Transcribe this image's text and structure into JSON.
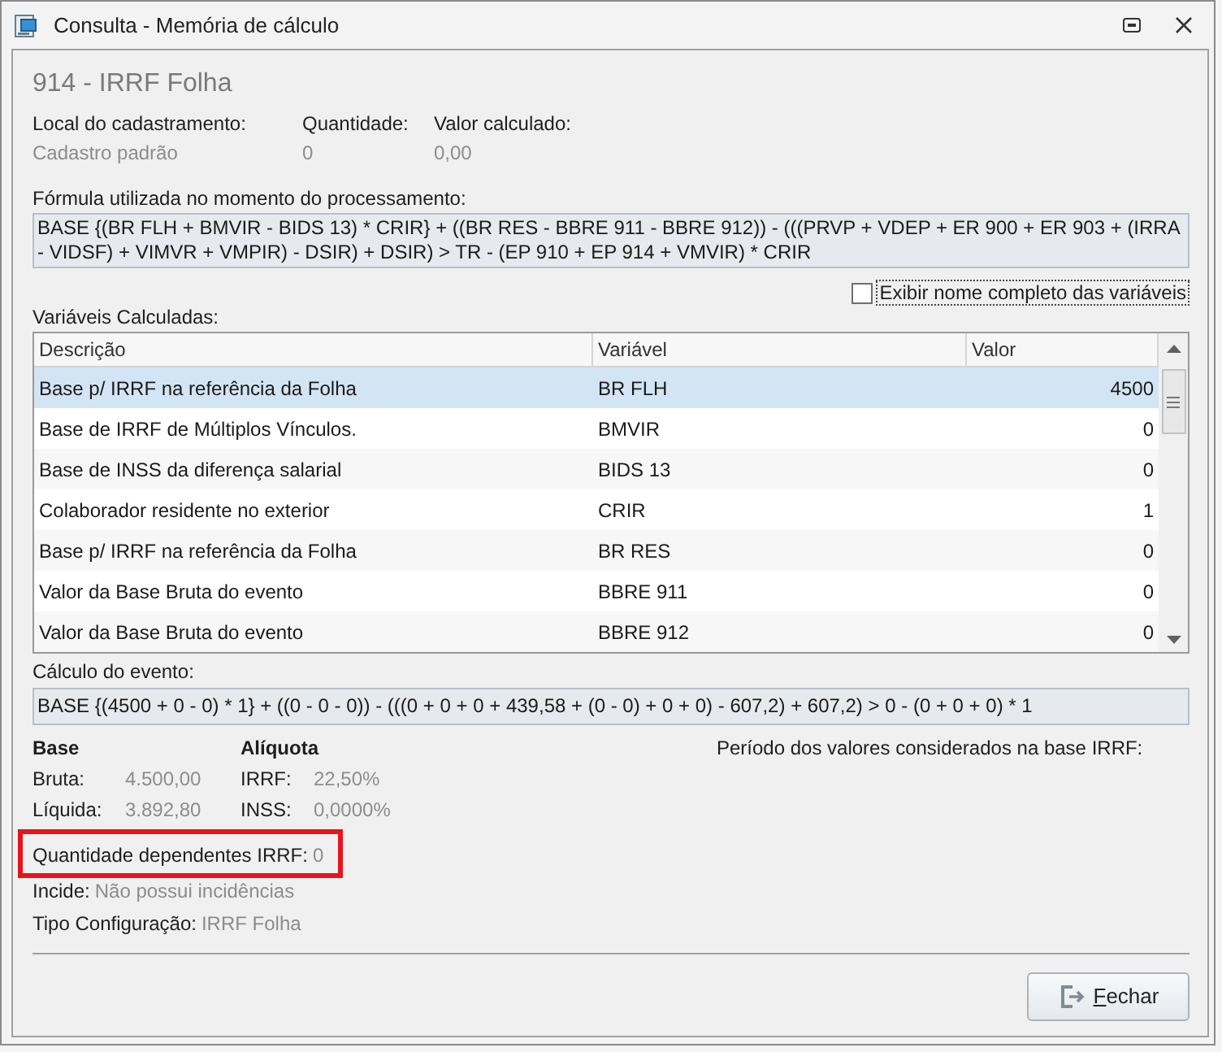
{
  "window": {
    "title": "Consulta - Memória de cálculo"
  },
  "header": {
    "title": "914 - IRRF Folha"
  },
  "summary_fields": [
    {
      "label": "Local do cadastramento:",
      "value": "Cadastro padrão"
    },
    {
      "label": "Quantidade:",
      "value": "0"
    },
    {
      "label": "Valor calculado:",
      "value": "0,00"
    }
  ],
  "formula": {
    "label": "Fórmula utilizada no momento do processamento:",
    "text": "BASE {(BR FLH + BMVIR - BIDS 13) * CRIR} + ((BR RES - BBRE 911 - BBRE 912)) - (((PRVP + VDEP + ER 900 + ER 903 + (IRRA - VIDSF) + VIMVR + VMPIR) - DSIR) + DSIR) > TR - (EP 910 + EP 914 + VMVIR) * CRIR"
  },
  "show_full_names": {
    "label": "Exibir nome completo das variáveis",
    "checked": false
  },
  "variables_table": {
    "label": "Variáveis Calculadas:",
    "columns": [
      "Descrição",
      "Variável",
      "Valor"
    ],
    "rows": [
      {
        "cells": [
          "Base p/ IRRF na referência da Folha",
          "BR FLH",
          "4500"
        ],
        "selected": true
      },
      {
        "cells": [
          "Base de IRRF de Múltiplos Vínculos.",
          "BMVIR",
          "0"
        ],
        "selected": false
      },
      {
        "cells": [
          "Base de INSS da diferença salarial",
          "BIDS 13",
          "0"
        ],
        "selected": false
      },
      {
        "cells": [
          "Colaborador residente no exterior",
          "CRIR",
          "1"
        ],
        "selected": false
      },
      {
        "cells": [
          "Base p/ IRRF na referência da Folha",
          "BR RES",
          "0"
        ],
        "selected": false
      },
      {
        "cells": [
          "Valor da Base Bruta do evento",
          "BBRE 911",
          "0"
        ],
        "selected": false
      },
      {
        "cells": [
          "Valor da Base Bruta do evento",
          "BBRE 912",
          "0"
        ],
        "selected": false
      }
    ]
  },
  "calculation": {
    "label": "Cálculo do evento:",
    "text": "BASE {(4500 + 0 - 0) * 1} + ((0 - 0 - 0)) - (((0 + 0 + 0 + 439,58 + (0 - 0) + 0 + 0) - 607,2) + 607,2) > 0 - (0 + 0 + 0) * 1"
  },
  "base": {
    "title": "Base",
    "items": [
      {
        "label": "Bruta:",
        "value": "4.500,00"
      },
      {
        "label": "Líquida:",
        "value": "3.892,80"
      }
    ]
  },
  "rate": {
    "title": "Alíquota",
    "items": [
      {
        "label": "IRRF:",
        "value": "22,50%"
      },
      {
        "label": "INSS:",
        "value": "0,0000%"
      }
    ]
  },
  "period": {
    "label": "Período dos valores considerados na base IRRF:"
  },
  "details": [
    {
      "label": "Quantidade dependentes IRRF:",
      "value": "0",
      "highlighted": true
    },
    {
      "label": "Incide:",
      "value": "Não possui incidências",
      "highlighted": false
    },
    {
      "label": "Tipo Configuração:",
      "value": "IRRF Folha",
      "highlighted": false
    }
  ],
  "buttons": [
    {
      "kind": "close",
      "label": "Fechar"
    }
  ]
}
